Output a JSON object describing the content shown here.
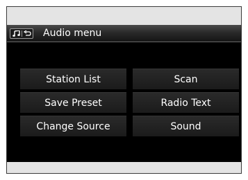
{
  "screen": {
    "title": "Audio menu",
    "header_icons": [
      "music-note-icon",
      "back-arrow-icon"
    ]
  },
  "menu": {
    "station_list": "Station List",
    "scan": "Scan",
    "save_preset": "Save Preset",
    "radio_text": "Radio Text",
    "change_source": "Change Source",
    "sound": "Sound"
  },
  "colors": {
    "screen_background": "#000000",
    "button_background": "#222222",
    "text": "#ffffff",
    "frame": "#e4e4e4"
  }
}
